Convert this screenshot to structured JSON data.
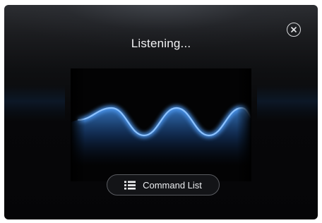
{
  "dialog": {
    "title": "Listening...",
    "close_icon": "close-circle-icon",
    "command_button": {
      "label": "Command List",
      "icon": "list-icon"
    }
  },
  "waveform": {
    "color": "#5a9fe6",
    "glow_color": "#1e4f8f"
  }
}
